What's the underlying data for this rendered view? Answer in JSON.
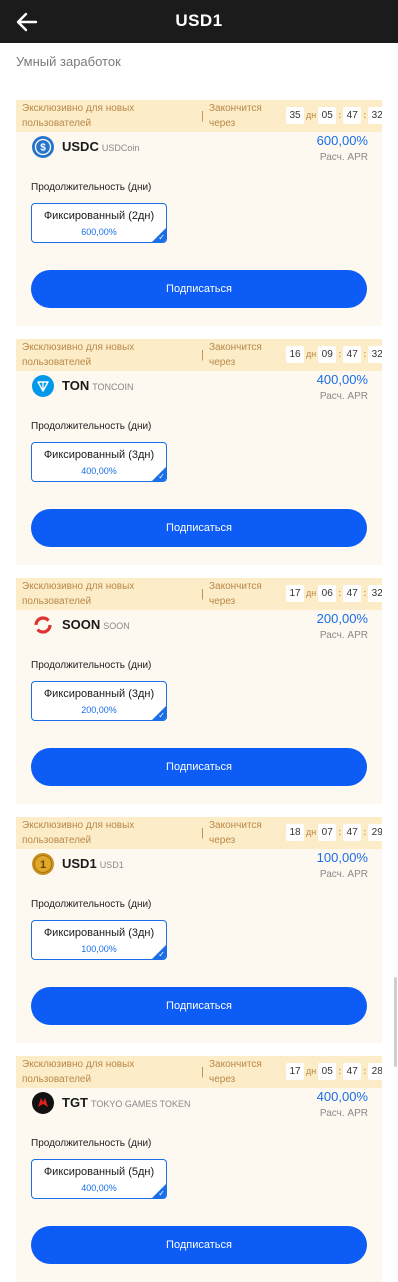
{
  "header": {
    "title": "USD1"
  },
  "subtitle": "Умный заработок",
  "colors": {
    "accent": "#0c5cf5",
    "header_bg": "#1b1b1b",
    "banner_bg": "#fdecc8"
  },
  "cards": [
    {
      "banner_left": "Эксклюзивно для новых пользователей",
      "banner_sep": "|",
      "banner_mid": "Закончится через",
      "timer": {
        "days": "35",
        "days_unit": "дн",
        "hours": "05",
        "minutes": "47",
        "seconds": "32"
      },
      "coin": {
        "symbol": "USDC",
        "full": "USDCoin",
        "icon": "usdc-icon"
      },
      "apr_value": "600,00%",
      "apr_label": "Расч. APR",
      "duration_label": "Продолжительность (дни)",
      "option": {
        "title": "Фиксированный (2дн)",
        "rate": "600,00%"
      },
      "button": "Подписаться"
    },
    {
      "banner_left": "Эксклюзивно для новых пользователей",
      "banner_sep": "|",
      "banner_mid": "Закончится через",
      "timer": {
        "days": "16",
        "days_unit": "дн",
        "hours": "09",
        "minutes": "47",
        "seconds": "32"
      },
      "coin": {
        "symbol": "TON",
        "full": "TONCOIN",
        "icon": "ton-icon"
      },
      "apr_value": "400,00%",
      "apr_label": "Расч. APR",
      "duration_label": "Продолжительность (дни)",
      "option": {
        "title": "Фиксированный (3дн)",
        "rate": "400,00%"
      },
      "button": "Подписаться"
    },
    {
      "banner_left": "Эксклюзивно для новых пользователей",
      "banner_sep": "|",
      "banner_mid": "Закончится через",
      "timer": {
        "days": "17",
        "days_unit": "дн",
        "hours": "06",
        "minutes": "47",
        "seconds": "32"
      },
      "coin": {
        "symbol": "SOON",
        "full": "SOON",
        "icon": "soon-icon"
      },
      "apr_value": "200,00%",
      "apr_label": "Расч. APR",
      "duration_label": "Продолжительность (дни)",
      "option": {
        "title": "Фиксированный (3дн)",
        "rate": "200,00%"
      },
      "button": "Подписаться"
    },
    {
      "banner_left": "Эксклюзивно для новых пользователей",
      "banner_sep": "|",
      "banner_mid": "Закончится через",
      "timer": {
        "days": "18",
        "days_unit": "дн",
        "hours": "07",
        "minutes": "47",
        "seconds": "29"
      },
      "coin": {
        "symbol": "USD1",
        "full": "USD1",
        "icon": "usd1-icon"
      },
      "apr_value": "100,00%",
      "apr_label": "Расч. APR",
      "duration_label": "Продолжительность (дни)",
      "option": {
        "title": "Фиксированный (3дн)",
        "rate": "100,00%"
      },
      "button": "Подписаться"
    },
    {
      "banner_left": "Эксклюзивно для новых пользователей",
      "banner_sep": "|",
      "banner_mid": "Закончится через",
      "timer": {
        "days": "17",
        "days_unit": "дн",
        "hours": "05",
        "minutes": "47",
        "seconds": "28"
      },
      "coin": {
        "symbol": "TGT",
        "full": "TOKYO GAMES TOKEN",
        "icon": "tgt-icon"
      },
      "apr_value": "400,00%",
      "apr_label": "Расч. APR",
      "duration_label": "Продолжительность (дни)",
      "option": {
        "title": "Фиксированный (5дн)",
        "rate": "400,00%"
      },
      "button": "Подписаться"
    }
  ]
}
